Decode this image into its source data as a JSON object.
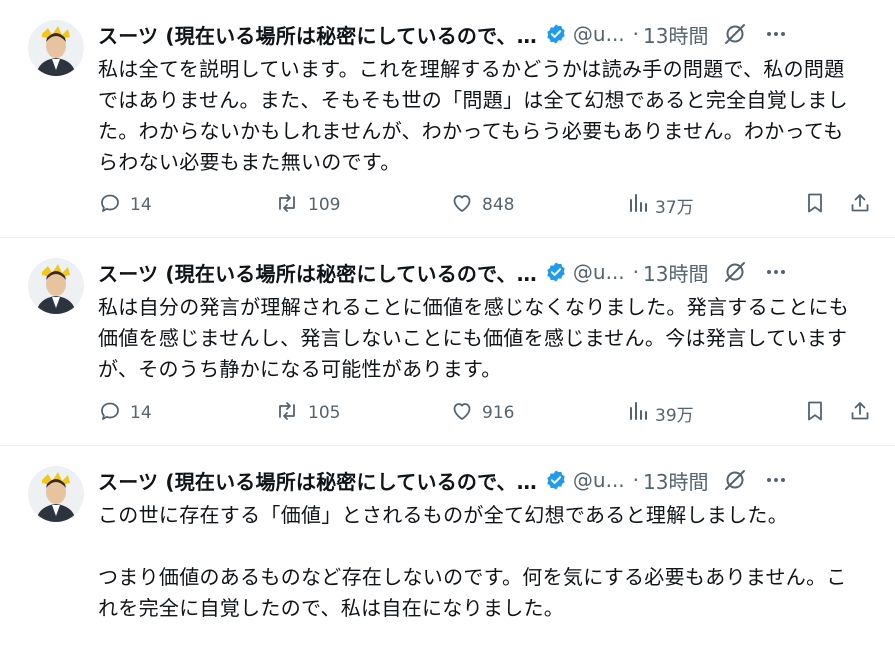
{
  "author": {
    "name": "スーツ (現在いる場所は秘密にしているので、…",
    "handle": "@u..."
  },
  "tweets": [
    {
      "time": "13時間",
      "paragraphs": [
        "私は全てを説明しています。これを理解するかどうかは読み手の問題で、私の問題ではありません。また、そもそも世の「問題」は全て幻想であると完全自覚しました。わからないかもしれませんが、わかってもらう必要もありません。わかってもらわない必要もまた無いのです。"
      ],
      "replies": "14",
      "reposts": "109",
      "likes": "848",
      "views": "37万"
    },
    {
      "time": "13時間",
      "paragraphs": [
        "私は自分の発言が理解されることに価値を感じなくなりました。発言することにも価値を感じませんし、発言しないことにも価値を感じません。今は発言していますが、そのうち静かになる可能性があります。"
      ],
      "replies": "14",
      "reposts": "105",
      "likes": "916",
      "views": "39万"
    },
    {
      "time": "13時間",
      "paragraphs": [
        "この世に存在する「価値」とされるものが全て幻想であると理解しました。",
        "つまり価値のあるものなど存在しないのです。何を気にする必要もありません。これを完全に自覚したので、私は自在になりました。"
      ]
    }
  ],
  "colors": {
    "text": "#0f1419",
    "secondary": "#536471",
    "verified": "#1d9bf0",
    "divider": "#eff3f4"
  },
  "icons": [
    "avatar",
    "verified-badge-icon",
    "grok-icon",
    "more-icon",
    "reply-icon",
    "repost-icon",
    "like-icon",
    "views-icon",
    "bookmark-icon",
    "share-icon"
  ]
}
